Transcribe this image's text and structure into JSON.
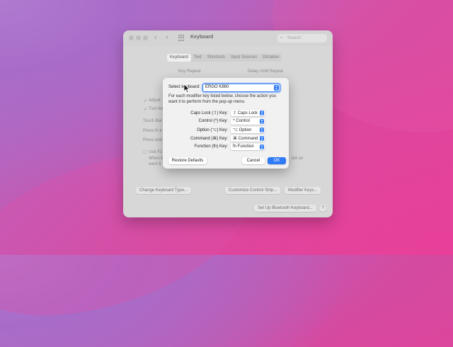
{
  "window": {
    "title": "Keyboard",
    "search_placeholder": "Search",
    "tabs": [
      "Keyboard",
      "Text",
      "Shortcuts",
      "Input Sources",
      "Dictation"
    ],
    "active_tab": "Keyboard",
    "key_repeat_label": "Key Repeat",
    "delay_label": "Delay Until Repeat",
    "adjust_label": "Adjust",
    "turn_label": "Turn ke",
    "touch_bar_label": "Touch Bar",
    "press_fn_label": "Press fn k",
    "press_and_label": "Press and",
    "use_f_label": "Use F1",
    "when_label": "When k",
    "each_label": "each k",
    "led_on_label": "led on",
    "buttons": {
      "change_type": "Change Keyboard Type...",
      "customize_strip": "Customize Control Strip...",
      "modifier_keys": "Modifier Keys...",
      "bluetooth": "Set Up Bluetooth Keyboard...",
      "help": "?"
    }
  },
  "sheet": {
    "select_label": "Select keyboard:",
    "selected_keyboard": "ERGO K860",
    "description": "For each modifier key listed below, choose the action you want it to perform from the pop-up menu.",
    "rows": [
      {
        "key": "Caps Lock (⇪) Key:",
        "action": "⇪ Caps Lock"
      },
      {
        "key": "Control (^) Key:",
        "action": "^ Control"
      },
      {
        "key": "Option (⌥) Key:",
        "action": "⌥ Option"
      },
      {
        "key": "Command (⌘) Key:",
        "action": "⌘ Command"
      },
      {
        "key": "Function (fn) Key:",
        "action": "fn Function"
      }
    ],
    "restore_defaults": "Restore Defaults",
    "cancel": "Cancel",
    "ok": "OK"
  },
  "colors": {
    "accent": "#2e7af7",
    "window_bg": "#d7d7d7",
    "sheet_bg": "#f1f1f1"
  }
}
